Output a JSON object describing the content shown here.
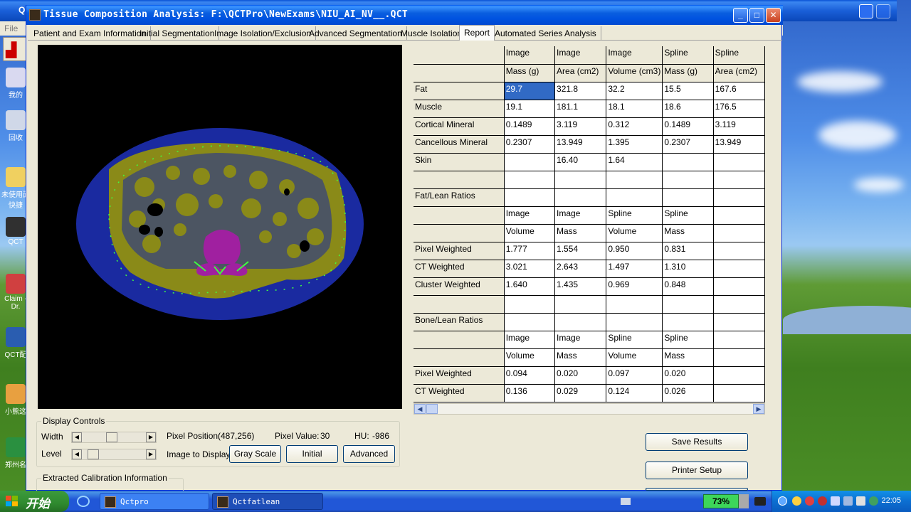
{
  "background_window": {
    "title_fragment": "Q",
    "menu_fragment": "File"
  },
  "desktop_icons": [
    {
      "label": "我的",
      "color": "#d9d9f0"
    },
    {
      "label": "回收",
      "color": "#d0d8e8"
    },
    {
      "label": "未使用面快捷",
      "color": "#f0d060"
    },
    {
      "label": "QCT",
      "color": "#303030"
    },
    {
      "label": "Claim - Dr.",
      "color": "#d04040"
    },
    {
      "label": "QCT配",
      "color": "#2a5db0"
    },
    {
      "label": "小熊这",
      "color": "#e8a040"
    },
    {
      "label": "郑州名",
      "color": "#2a9040"
    }
  ],
  "window": {
    "title": "Tissue Composition Analysis: F:\\QCTPro\\NewExams\\NIU_AI_NV__.QCT",
    "minimize_label": "_",
    "maximize_label": "□",
    "close_label": "✕"
  },
  "tabs": [
    {
      "label": "Patient and Exam Information"
    },
    {
      "label": "Initial Segmentation"
    },
    {
      "label": "Image Isolation/Exclusion"
    },
    {
      "label": "Advanced Segmentation"
    },
    {
      "label": "Muscle Isolation"
    },
    {
      "label": "Report"
    },
    {
      "label": "Automated Series Analysis"
    }
  ],
  "display_controls": {
    "title": "Display Controls",
    "width_label": "Width",
    "level_label": "Level",
    "width_fraction": 0.45,
    "level_fraction": 0.1,
    "pixel_position_label": "Pixel Position:",
    "pixel_position_value": "(487,256)",
    "pixel_value_label": "Pixel Value:",
    "pixel_value_value": "30",
    "hu_label": "HU:",
    "hu_value": "-986",
    "image_to_display_label": "Image to Display:",
    "gray_scale_label": "Gray Scale",
    "initial_label": "Initial",
    "advanced_label": "Advanced"
  },
  "calibration": {
    "title": "Extracted Calibration Information"
  },
  "actions": {
    "save_results_label": "Save Results",
    "printer_setup_label": "Printer Setup"
  },
  "grid": {
    "selected_cell": [
      2,
      1
    ],
    "rows": [
      [
        "",
        "Image",
        "Image",
        "Image",
        "Spline",
        "Spline"
      ],
      [
        "",
        "Mass (g)",
        "Area (cm2)",
        "Volume (cm3)",
        "Mass (g)",
        "Area (cm2)"
      ],
      [
        "Fat",
        "29.7",
        "321.8",
        "32.2",
        "15.5",
        "167.6"
      ],
      [
        "Muscle",
        "19.1",
        "181.1",
        "18.1",
        "18.6",
        "176.5"
      ],
      [
        "Cortical Mineral",
        "0.1489",
        "3.119",
        "0.312",
        "0.1489",
        "3.119"
      ],
      [
        "Cancellous Mineral",
        "0.2307",
        "13.949",
        "1.395",
        "0.2307",
        "13.949"
      ],
      [
        "Skin",
        "",
        "16.40",
        "1.64",
        "",
        ""
      ],
      [
        "",
        "",
        "",
        "",
        "",
        ""
      ],
      [
        "Fat/Lean Ratios",
        "",
        "",
        "",
        "",
        ""
      ],
      [
        "",
        "Image",
        "Image",
        "Spline",
        "Spline",
        ""
      ],
      [
        "",
        "Volume",
        "Mass",
        "Volume",
        "Mass",
        ""
      ],
      [
        "Pixel Weighted",
        "1.777",
        "1.554",
        "0.950",
        "0.831",
        ""
      ],
      [
        "CT Weighted",
        "3.021",
        "2.643",
        "1.497",
        "1.310",
        ""
      ],
      [
        "Cluster Weighted",
        "1.640",
        "1.435",
        "0.969",
        "0.848",
        ""
      ],
      [
        "",
        "",
        "",
        "",
        "",
        ""
      ],
      [
        "Bone/Lean Ratios",
        "",
        "",
        "",
        "",
        ""
      ],
      [
        "",
        "Image",
        "Image",
        "Spline",
        "Spline",
        ""
      ],
      [
        "",
        "Volume",
        "Mass",
        "Volume",
        "Mass",
        ""
      ],
      [
        "Pixel Weighted",
        "0.094",
        "0.020",
        "0.097",
        "0.020",
        ""
      ],
      [
        "CT Weighted",
        "0.136",
        "0.029",
        "0.124",
        "0.026",
        ""
      ]
    ]
  },
  "taskbar": {
    "start_label": "开始",
    "buttons": [
      {
        "label": "Qctpro"
      },
      {
        "label": "Qctfatlean"
      }
    ],
    "battery_label": "73%",
    "clock": "22:05"
  },
  "colors": {
    "ct_fat": "#1a2aa0",
    "ct_muscle": "#8a8a18",
    "ct_bone": "#a020a0",
    "ct_contour": "#40ff40",
    "selection": "#316ac5"
  }
}
